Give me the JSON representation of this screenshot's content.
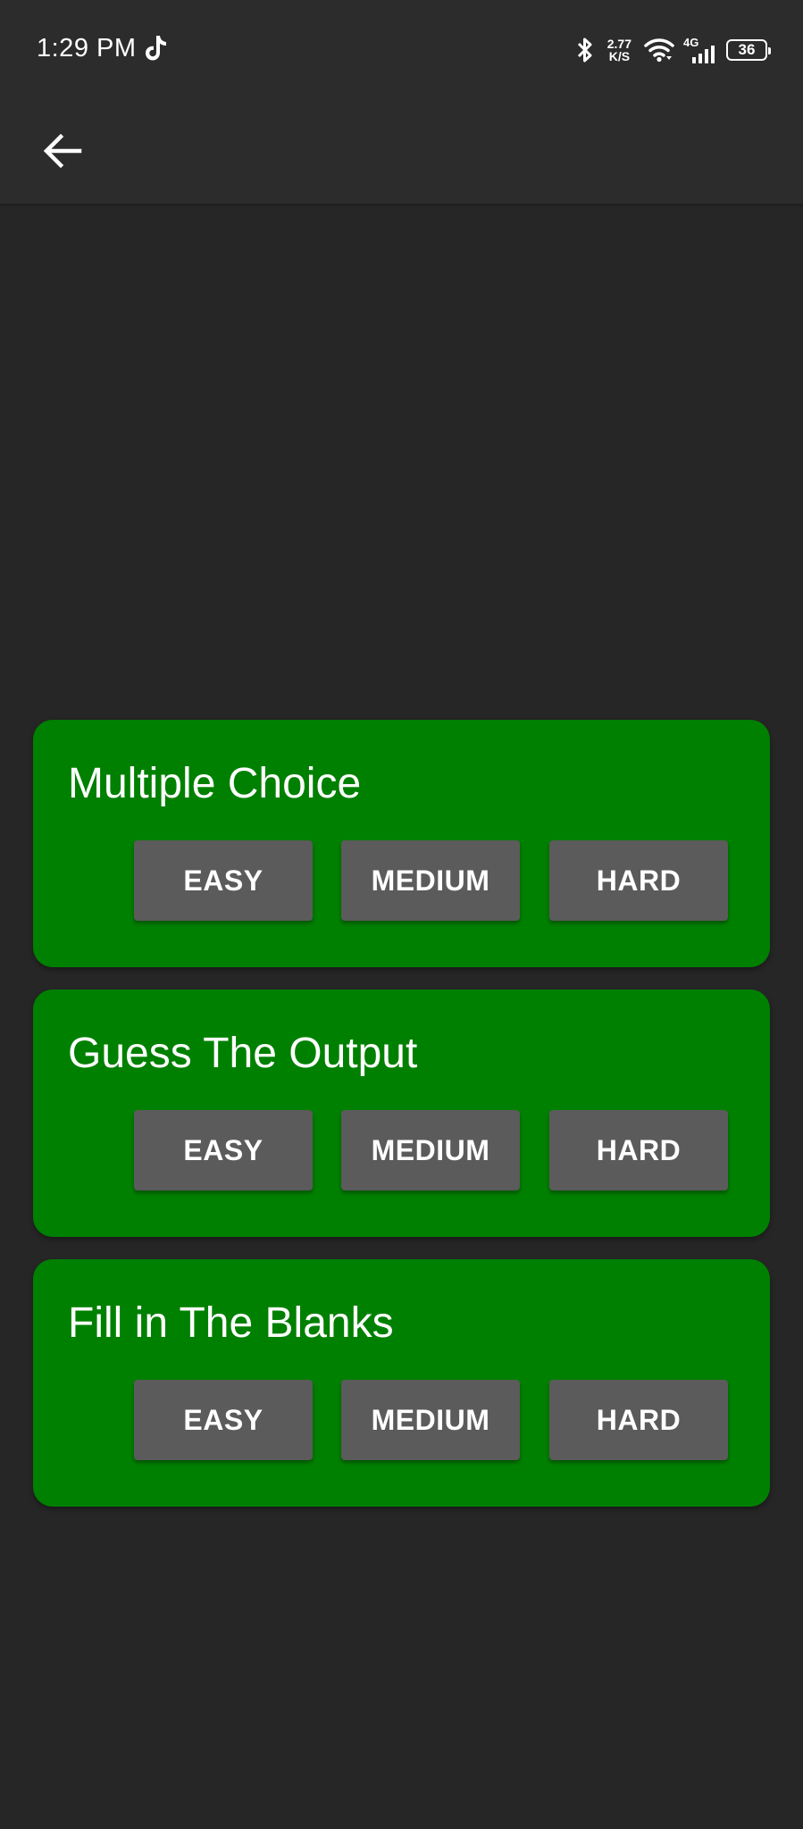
{
  "status_bar": {
    "time": "1:29 PM",
    "speed_value": "2.77",
    "speed_unit": "K/S",
    "network_type": "4G",
    "battery_level": "36",
    "icons": [
      "tiktok-icon",
      "bluetooth-icon",
      "wifi-icon",
      "signal-icon",
      "battery-icon"
    ]
  },
  "app_bar": {
    "back_icon": "arrow-left-icon"
  },
  "colors": {
    "background": "#262626",
    "bar": "#2c2c2c",
    "card": "#008000",
    "button": "#5b5b5b",
    "text": "#ffffff"
  },
  "cards": [
    {
      "title": "Multiple Choice",
      "buttons": {
        "easy": "EASY",
        "medium": "MEDIUM",
        "hard": "HARD"
      }
    },
    {
      "title": "Guess The Output",
      "buttons": {
        "easy": "EASY",
        "medium": "MEDIUM",
        "hard": "HARD"
      }
    },
    {
      "title": "Fill in The Blanks",
      "buttons": {
        "easy": "EASY",
        "medium": "MEDIUM",
        "hard": "HARD"
      }
    }
  ]
}
